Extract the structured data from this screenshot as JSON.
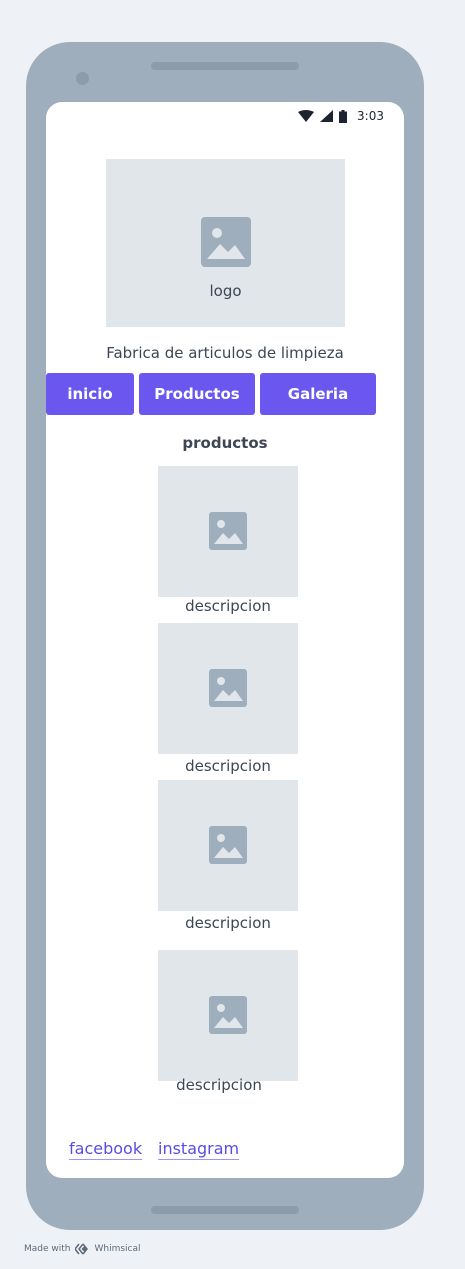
{
  "status_bar": {
    "time": "3:03"
  },
  "header": {
    "logo_label": "logo",
    "tagline": "Fabrica de articulos de limpieza"
  },
  "nav": {
    "inicio": "inicio",
    "productos": "Productos",
    "galeria": "Galeria"
  },
  "products": {
    "title": "productos",
    "items": [
      {
        "description": "descripcion"
      },
      {
        "description": "descripcion"
      },
      {
        "description": "descripcion"
      },
      {
        "description": "descripcion"
      }
    ]
  },
  "social": {
    "facebook": "facebook",
    "instagram": "instagram"
  },
  "footer": {
    "made_with": "Made with",
    "brand": "Whimsical"
  },
  "colors": {
    "accent": "#6b57ef",
    "link": "#5a4be6",
    "placeholder": "#e1e6eb",
    "frame": "#9eaebc",
    "background": "#eef2f6"
  },
  "icons": [
    "wifi-icon",
    "cellular-signal-icon",
    "battery-icon",
    "image-placeholder-icon",
    "whimsical-logo-icon"
  ]
}
